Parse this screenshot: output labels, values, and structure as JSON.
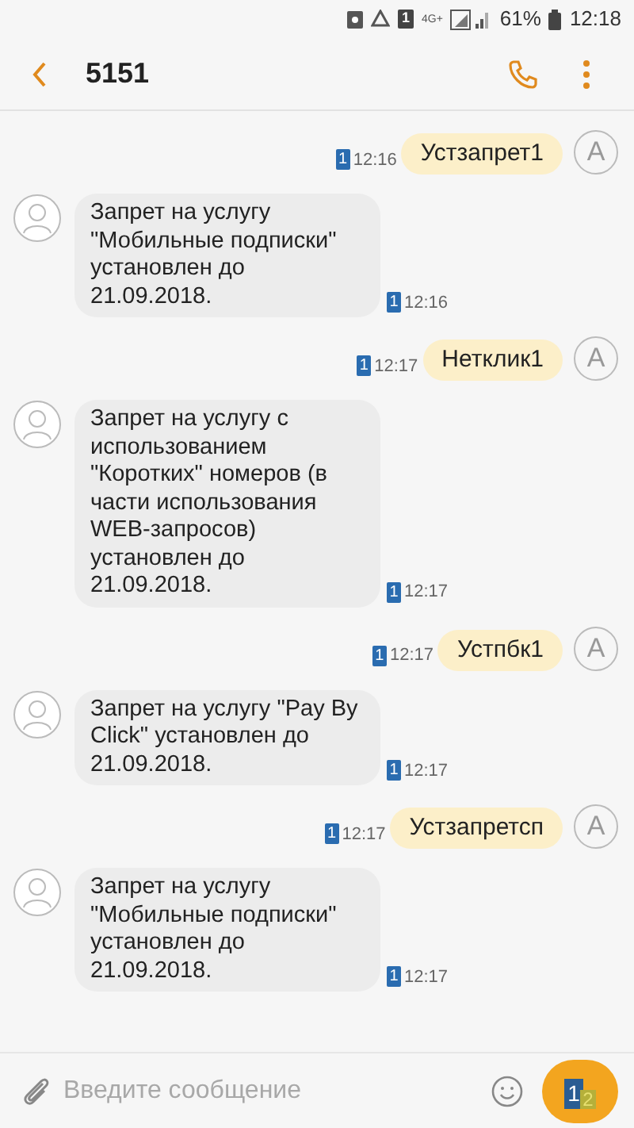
{
  "status_bar": {
    "sim": "1",
    "network": "4G+",
    "battery": "61%",
    "time": "12:18"
  },
  "header": {
    "title": "5151"
  },
  "messages": [
    {
      "kind": "sent",
      "text": "Устзапрет1",
      "sim": "1",
      "time": "12:16",
      "avatar": "A"
    },
    {
      "kind": "received",
      "text": "Запрет на услугу \"Мобильные подписки\" установлен до 21.09.2018.",
      "sim": "1",
      "time": "12:16"
    },
    {
      "kind": "sent",
      "text": "Нетклик1",
      "sim": "1",
      "time": "12:17",
      "avatar": "A"
    },
    {
      "kind": "received",
      "text": "Запрет на услугу с использованием \"Коротких\" номеров (в части использования WEB-запросов) установлен до 21.09.2018.",
      "sim": "1",
      "time": "12:17"
    },
    {
      "kind": "sent",
      "text": "Устпбк1",
      "sim": "1",
      "time": "12:17",
      "avatar": "A"
    },
    {
      "kind": "received",
      "text": "Запрет на услугу \"Pay By Click\" установлен до 21.09.2018.",
      "sim": "1",
      "time": "12:17"
    },
    {
      "kind": "sent",
      "text": "Устзапретсп",
      "sim": "1",
      "time": "12:17",
      "avatar": "A"
    },
    {
      "kind": "received",
      "text": "Запрет на услугу \"Мобильные подписки\" установлен до 21.09.2018.",
      "sim": "1",
      "time": "12:17"
    }
  ],
  "composer": {
    "placeholder": "Введите сообщение",
    "send_sim": "1",
    "alt_sim": "2"
  }
}
